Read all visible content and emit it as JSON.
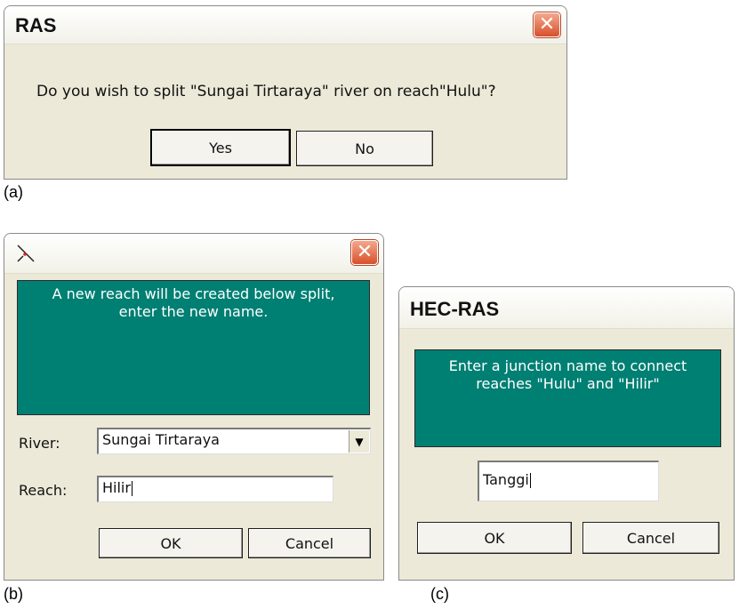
{
  "dialog_a": {
    "title": "RAS",
    "message": "Do you wish to split \"Sungai Tirtaraya\" river on reach\"Hulu\"?",
    "yes_label": "Yes",
    "no_label": "No",
    "close_symbol": "✕"
  },
  "dialog_b": {
    "info_line1": "A new reach will be created below split,",
    "info_line2": "enter the new name.",
    "river_label": "River:",
    "river_value": "Sungai Tirtaraya",
    "reach_label": "Reach:",
    "reach_value": "Hilir",
    "ok_label": "OK",
    "cancel_label": "Cancel",
    "close_symbol": "✕",
    "dropdown_arrow": "▼"
  },
  "dialog_c": {
    "title": "HEC-RAS",
    "info_line1": "Enter a junction name to connect",
    "info_line2": "reaches \"Hulu\" and \"Hilir\"",
    "junction_value": "Tanggi",
    "ok_label": "OK",
    "cancel_label": "Cancel"
  },
  "captions": {
    "a": "(a)",
    "b": "(b)",
    "c": "(c)"
  },
  "colors": {
    "teal_panel": "#007f73",
    "dialog_bg": "#ece9d8",
    "close_button": "#d8502b"
  }
}
